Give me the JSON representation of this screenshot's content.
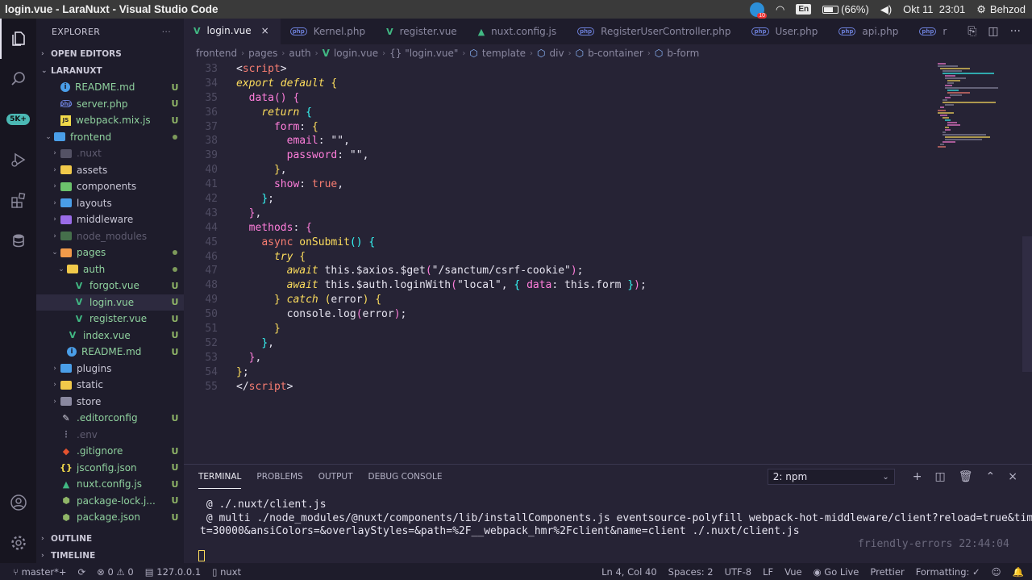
{
  "system": {
    "window_title": "login.vue - LaraNuxt - Visual Studio Code",
    "notif_badge": "10",
    "keyboard": "En",
    "battery": "(66%)",
    "datetime": "Okt 11  23:01",
    "user": "Behzod"
  },
  "activity": {
    "badge": "5K+"
  },
  "sidebar": {
    "header": "EXPLORER",
    "more": "···",
    "open_editors": "OPEN EDITORS",
    "project": "LARANUXT",
    "outline": "OUTLINE",
    "timeline": "TIMELINE",
    "tree": [
      {
        "label": "README.md",
        "depth": 1,
        "icon": "info",
        "status": "U"
      },
      {
        "label": "server.php",
        "depth": 1,
        "icon": "php",
        "status": "U"
      },
      {
        "label": "webpack.mix.js",
        "depth": 1,
        "icon": "js",
        "status": "U"
      },
      {
        "label": "frontend",
        "depth": 0,
        "icon": "folder-blue",
        "folder": true,
        "open": true,
        "status": "dot"
      },
      {
        "label": ".nuxt",
        "depth": 1,
        "icon": "folder-grey",
        "folder": true,
        "dim": true
      },
      {
        "label": "assets",
        "depth": 1,
        "icon": "folder-yellow",
        "folder": true
      },
      {
        "label": "components",
        "depth": 1,
        "icon": "folder-green",
        "folder": true
      },
      {
        "label": "layouts",
        "depth": 1,
        "icon": "folder-blue",
        "folder": true
      },
      {
        "label": "middleware",
        "depth": 1,
        "icon": "folder-purple",
        "folder": true
      },
      {
        "label": "node_modules",
        "depth": 1,
        "icon": "folder-green",
        "folder": true,
        "dim": true
      },
      {
        "label": "pages",
        "depth": 1,
        "icon": "folder-orange",
        "folder": true,
        "open": true,
        "status": "dot"
      },
      {
        "label": "auth",
        "depth": 2,
        "icon": "folder-yellow",
        "folder": true,
        "open": true,
        "status": "dot"
      },
      {
        "label": "forgot.vue",
        "depth": 3,
        "icon": "vue",
        "status": "U"
      },
      {
        "label": "login.vue",
        "depth": 3,
        "icon": "vue",
        "status": "U",
        "selected": true
      },
      {
        "label": "register.vue",
        "depth": 3,
        "icon": "vue",
        "status": "U"
      },
      {
        "label": "index.vue",
        "depth": 2,
        "icon": "vue",
        "status": "U"
      },
      {
        "label": "README.md",
        "depth": 2,
        "icon": "info",
        "status": "U"
      },
      {
        "label": "plugins",
        "depth": 1,
        "icon": "folder-blue",
        "folder": true
      },
      {
        "label": "static",
        "depth": 1,
        "icon": "folder-yellow",
        "folder": true
      },
      {
        "label": "store",
        "depth": 1,
        "icon": "folder-grey",
        "folder": true
      },
      {
        "label": ".editorconfig",
        "depth": 1,
        "icon": "editorconfig",
        "status": "U"
      },
      {
        "label": ".env",
        "depth": 1,
        "icon": "env",
        "dim": true
      },
      {
        "label": ".gitignore",
        "depth": 1,
        "icon": "git",
        "status": "U"
      },
      {
        "label": "jsconfig.json",
        "depth": 1,
        "icon": "json",
        "status": "U"
      },
      {
        "label": "nuxt.config.js",
        "depth": 1,
        "icon": "nuxt",
        "status": "U"
      },
      {
        "label": "package-lock.j...",
        "depth": 1,
        "icon": "npm",
        "status": "U"
      },
      {
        "label": "package.json",
        "depth": 1,
        "icon": "npm",
        "status": "U"
      }
    ]
  },
  "tabs": [
    {
      "label": "login.vue",
      "icon": "vue",
      "active": true,
      "close": "×"
    },
    {
      "label": "Kernel.php",
      "icon": "php"
    },
    {
      "label": "register.vue",
      "icon": "vue"
    },
    {
      "label": "nuxt.config.js",
      "icon": "nuxt"
    },
    {
      "label": "RegisterUserController.php",
      "icon": "php"
    },
    {
      "label": "User.php",
      "icon": "php"
    },
    {
      "label": "api.php",
      "icon": "php"
    },
    {
      "label": "r",
      "icon": "php"
    }
  ],
  "breadcrumbs": [
    "frontend",
    "pages",
    "auth",
    "login.vue",
    "{} \"login.vue\"",
    "template",
    "div",
    "b-container",
    "b-form"
  ],
  "code": [
    {
      "n": "33",
      "t": [
        [
          "t-plain",
          "<"
        ],
        [
          "t-tag",
          "script"
        ],
        [
          "t-plain",
          ">"
        ]
      ]
    },
    {
      "n": "34",
      "t": [
        [
          "t-kw",
          "export default"
        ],
        [
          "t-plain",
          " "
        ],
        [
          "t-br1",
          "{"
        ]
      ]
    },
    {
      "n": "35",
      "t": [
        [
          "t-plain",
          "  "
        ],
        [
          "t-prop",
          "data"
        ],
        [
          "t-br2",
          "()"
        ],
        [
          "t-plain",
          " "
        ],
        [
          "t-br2",
          "{"
        ]
      ]
    },
    {
      "n": "36",
      "t": [
        [
          "t-plain",
          "    "
        ],
        [
          "t-kw",
          "return"
        ],
        [
          "t-plain",
          " "
        ],
        [
          "t-br3",
          "{"
        ]
      ]
    },
    {
      "n": "37",
      "t": [
        [
          "t-plain",
          "      "
        ],
        [
          "t-prop",
          "form"
        ],
        [
          "t-plain",
          ": "
        ],
        [
          "t-br1",
          "{"
        ]
      ]
    },
    {
      "n": "38",
      "t": [
        [
          "t-plain",
          "        "
        ],
        [
          "t-prop",
          "email"
        ],
        [
          "t-plain",
          ": "
        ],
        [
          "t-plain",
          "\"\""
        ],
        [
          "t-plain",
          ","
        ]
      ]
    },
    {
      "n": "39",
      "t": [
        [
          "t-plain",
          "        "
        ],
        [
          "t-prop",
          "password"
        ],
        [
          "t-plain",
          ": "
        ],
        [
          "t-plain",
          "\"\""
        ],
        [
          "t-plain",
          ","
        ]
      ]
    },
    {
      "n": "40",
      "t": [
        [
          "t-plain",
          "      "
        ],
        [
          "t-br1",
          "}"
        ],
        [
          "t-plain",
          ","
        ]
      ]
    },
    {
      "n": "41",
      "t": [
        [
          "t-plain",
          "      "
        ],
        [
          "t-prop",
          "show"
        ],
        [
          "t-plain",
          ": "
        ],
        [
          "t-bool",
          "true"
        ],
        [
          "t-plain",
          ","
        ]
      ]
    },
    {
      "n": "42",
      "t": [
        [
          "t-plain",
          "    "
        ],
        [
          "t-br3",
          "}"
        ],
        [
          "t-plain",
          ";"
        ]
      ]
    },
    {
      "n": "43",
      "t": [
        [
          "t-plain",
          "  "
        ],
        [
          "t-br2",
          "}"
        ],
        [
          "t-plain",
          ","
        ]
      ]
    },
    {
      "n": "44",
      "t": [
        [
          "t-plain",
          "  "
        ],
        [
          "t-prop",
          "methods"
        ],
        [
          "t-plain",
          ": "
        ],
        [
          "t-br2",
          "{"
        ]
      ]
    },
    {
      "n": "45",
      "t": [
        [
          "t-plain",
          "    "
        ],
        [
          "t-tag",
          "async"
        ],
        [
          "t-plain",
          " "
        ],
        [
          "t-br1",
          "onSubmit"
        ],
        [
          "t-br3",
          "()"
        ],
        [
          "t-plain",
          " "
        ],
        [
          "t-br3",
          "{"
        ]
      ]
    },
    {
      "n": "46",
      "t": [
        [
          "t-plain",
          "      "
        ],
        [
          "t-kw",
          "try"
        ],
        [
          "t-plain",
          " "
        ],
        [
          "t-br1",
          "{"
        ]
      ]
    },
    {
      "n": "47",
      "t": [
        [
          "t-plain",
          "        "
        ],
        [
          "t-kw",
          "await"
        ],
        [
          "t-plain",
          " this.$axios.$get"
        ],
        [
          "t-br2",
          "("
        ],
        [
          "t-plain",
          "\"/sanctum/csrf-cookie\""
        ],
        [
          "t-br2",
          ")"
        ],
        [
          "t-plain",
          ";"
        ]
      ]
    },
    {
      "n": "48",
      "t": [
        [
          "t-plain",
          "        "
        ],
        [
          "t-kw",
          "await"
        ],
        [
          "t-plain",
          " this.$auth.loginWith"
        ],
        [
          "t-br2",
          "("
        ],
        [
          "t-plain",
          "\"local\", "
        ],
        [
          "t-br3",
          "{"
        ],
        [
          "t-plain",
          " "
        ],
        [
          "t-prop",
          "data"
        ],
        [
          "t-plain",
          ": this.form "
        ],
        [
          "t-br3",
          "}"
        ],
        [
          "t-br2",
          ")"
        ],
        [
          "t-plain",
          ";"
        ]
      ]
    },
    {
      "n": "49",
      "t": [
        [
          "t-plain",
          "      "
        ],
        [
          "t-br1",
          "}"
        ],
        [
          "t-plain",
          " "
        ],
        [
          "t-kw",
          "catch"
        ],
        [
          "t-plain",
          " "
        ],
        [
          "t-br1",
          "("
        ],
        [
          "t-plain",
          "error"
        ],
        [
          "t-br1",
          ")"
        ],
        [
          "t-plain",
          " "
        ],
        [
          "t-br1",
          "{"
        ]
      ]
    },
    {
      "n": "50",
      "t": [
        [
          "t-plain",
          "        console.log"
        ],
        [
          "t-br2",
          "("
        ],
        [
          "t-plain",
          "error"
        ],
        [
          "t-br2",
          ")"
        ],
        [
          "t-plain",
          ";"
        ]
      ]
    },
    {
      "n": "51",
      "t": [
        [
          "t-plain",
          "      "
        ],
        [
          "t-br1",
          "}"
        ]
      ]
    },
    {
      "n": "52",
      "t": [
        [
          "t-plain",
          "    "
        ],
        [
          "t-br3",
          "}"
        ],
        [
          "t-plain",
          ","
        ]
      ]
    },
    {
      "n": "53",
      "t": [
        [
          "t-plain",
          "  "
        ],
        [
          "t-br2",
          "}"
        ],
        [
          "t-plain",
          ","
        ]
      ]
    },
    {
      "n": "54",
      "t": [
        [
          "t-br1",
          "}"
        ],
        [
          "t-plain",
          ";"
        ]
      ]
    },
    {
      "n": "55",
      "t": [
        [
          "t-plain",
          "</"
        ],
        [
          "t-tag",
          "script"
        ],
        [
          "t-plain",
          ">"
        ]
      ]
    }
  ],
  "panel": {
    "tabs": [
      "TERMINAL",
      "PROBLEMS",
      "OUTPUT",
      "DEBUG CONSOLE"
    ],
    "select": "2: npm",
    "lines": [
      " @ ./.nuxt/client.js",
      " @ multi ./node_modules/@nuxt/components/lib/installComponents.js eventsource-polyfill webpack-hot-middleware/client?reload=true&timeou",
      "t=30000&ansiColors=&overlayStyles=&path=%2F__webpack_hmr%2Fclient&name=client ./.nuxt/client.js"
    ],
    "timestamp": "friendly-errors 22:44:04"
  },
  "status": {
    "branch": "master*+",
    "errors": "0",
    "warnings": "0",
    "host": "127.0.0.1",
    "nuxt": "nuxt",
    "position": "Ln 4, Col 40",
    "spaces": "Spaces: 2",
    "encoding": "UTF-8",
    "eol": "LF",
    "language": "Vue",
    "golive": "Go Live",
    "prettier": "Prettier",
    "formatting": "Formatting: ✓"
  },
  "colors": {
    "accent": "#36f9f6",
    "vue": "#41b883",
    "php": "#6c7fd8",
    "keyword": "#fede5d",
    "property": "#ff7edb"
  }
}
